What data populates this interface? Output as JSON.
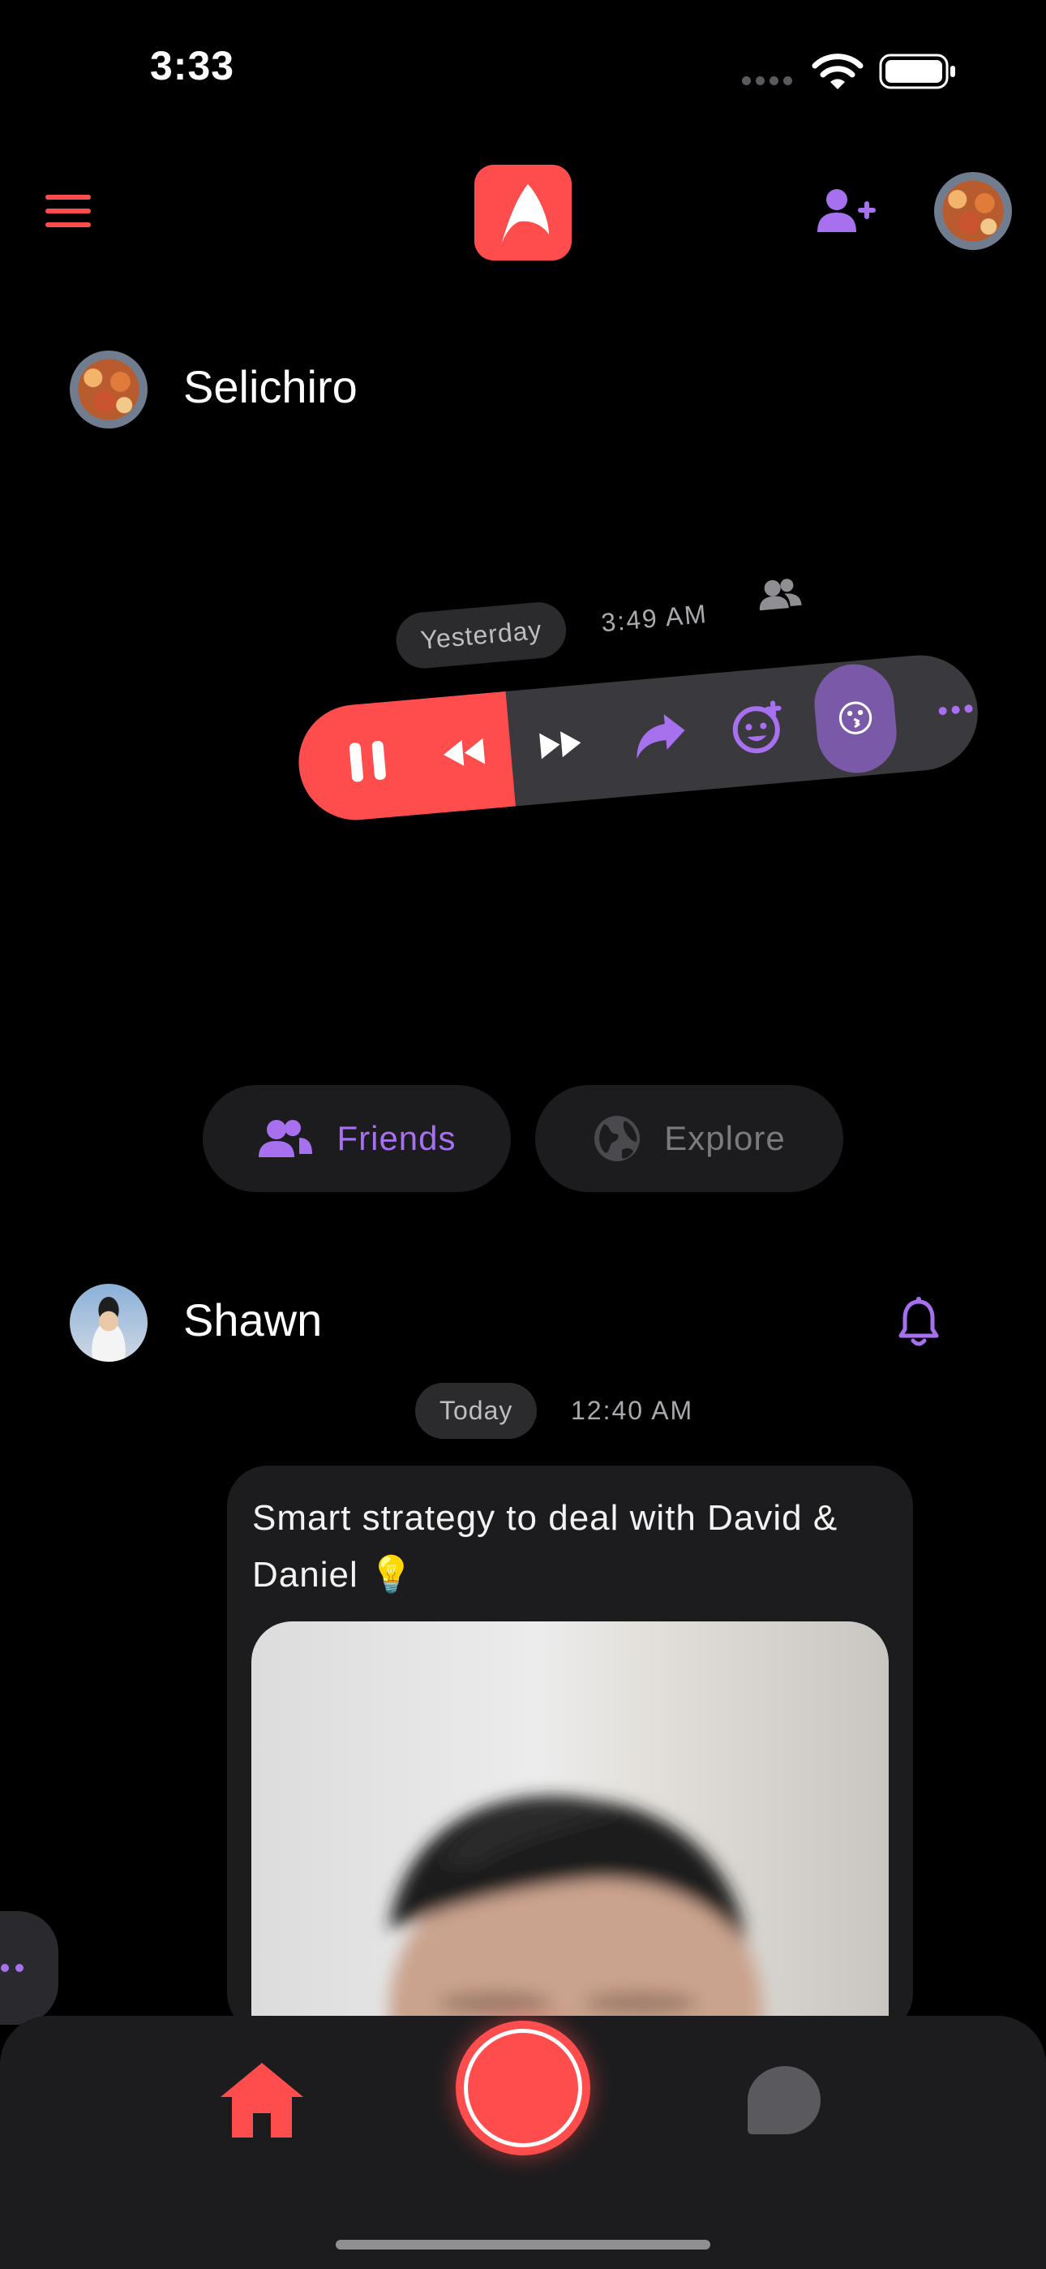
{
  "status_bar": {
    "time": "3:33"
  },
  "header": {
    "menu": "menu",
    "logo": "app-logo",
    "add_friend": "add-friend"
  },
  "feed_item_1": {
    "user": "Selichiro",
    "day": "Yesterday",
    "time": "3:49 AM",
    "reaction_emoji": "😗"
  },
  "tabs": [
    {
      "label": "Friends",
      "active": true
    },
    {
      "label": "Explore",
      "active": false
    }
  ],
  "feed_item_2": {
    "user": "Shawn",
    "day": "Today",
    "time": "12:40 AM",
    "caption": "Smart strategy to deal with David & Daniel 💡"
  },
  "colors": {
    "accent_red": "#ff4d4d",
    "accent_purple": "#a770ef",
    "surface": "#1c1c1e",
    "pill": "#2b2b2e"
  }
}
